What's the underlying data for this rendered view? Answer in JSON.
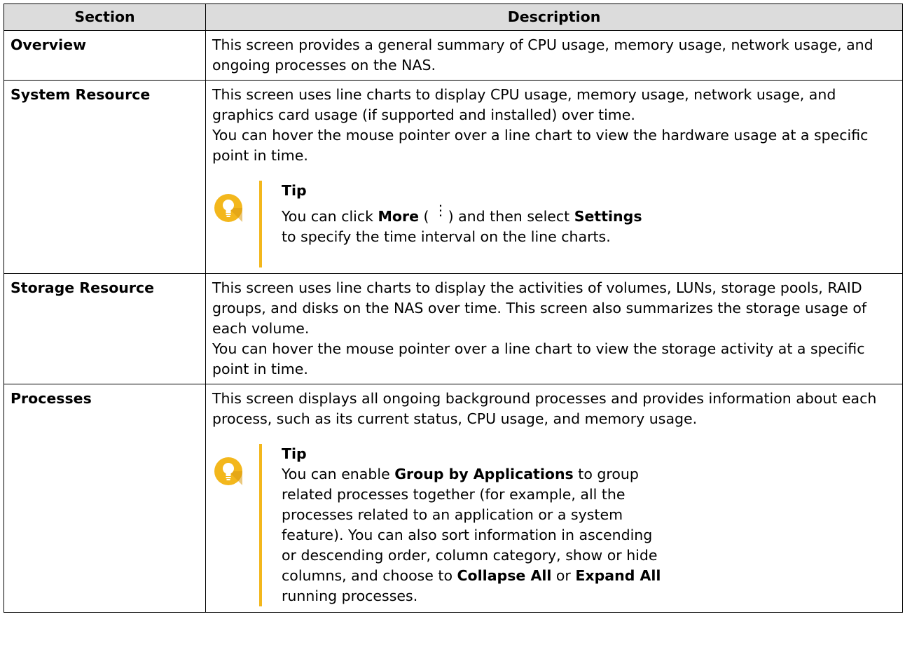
{
  "table": {
    "header": {
      "section": "Section",
      "description": "Description"
    },
    "rows": [
      {
        "section": "Overview",
        "p1": "This screen provides a general summary of CPU usage, memory usage, network usage, and ongoing processes on the NAS."
      },
      {
        "section": "System Resource",
        "p1": "This screen uses line charts to display CPU usage, memory usage, network usage, and graphics card usage (if supported and installed) over time.",
        "p2": "You can hover the mouse pointer over a line chart to view the hardware usage at a specific point in time.",
        "tip": {
          "title": "Tip",
          "t1": "You can click ",
          "b1": "More",
          "t2": " ( ",
          "t3": " ) and then select ",
          "b2": "Settings",
          "t4": " to specify the time interval on the line charts."
        }
      },
      {
        "section": "Storage Resource",
        "p1": "This screen uses line charts to display the activities of volumes, LUNs, storage pools, RAID groups, and disks on the NAS over time. This screen also summarizes the storage usage of each volume.",
        "p2": "You can hover the mouse pointer over a line chart to view the storage activity at a specific point in time."
      },
      {
        "section": "Processes",
        "p1": "This screen displays all ongoing background processes and provides information about each process, such as its current status, CPU usage, and memory usage.",
        "tip": {
          "title": "Tip",
          "t1": "You can enable ",
          "b1": "Group by Applications",
          "t2": " to group related processes together (for example, all the processes related to an application or a system feature). You can also sort information in ascending or descending order, column category, show or hide columns, and choose to ",
          "b2": "Collapse All",
          "t3": " or ",
          "b3": "Expand All",
          "t4": " running processes."
        }
      }
    ]
  },
  "colors": {
    "header_bg": "#dcdcdc",
    "tip_accent": "#f3b71c"
  },
  "icons": {
    "tip": "lightbulb-icon",
    "more": "kebab-menu-icon"
  }
}
